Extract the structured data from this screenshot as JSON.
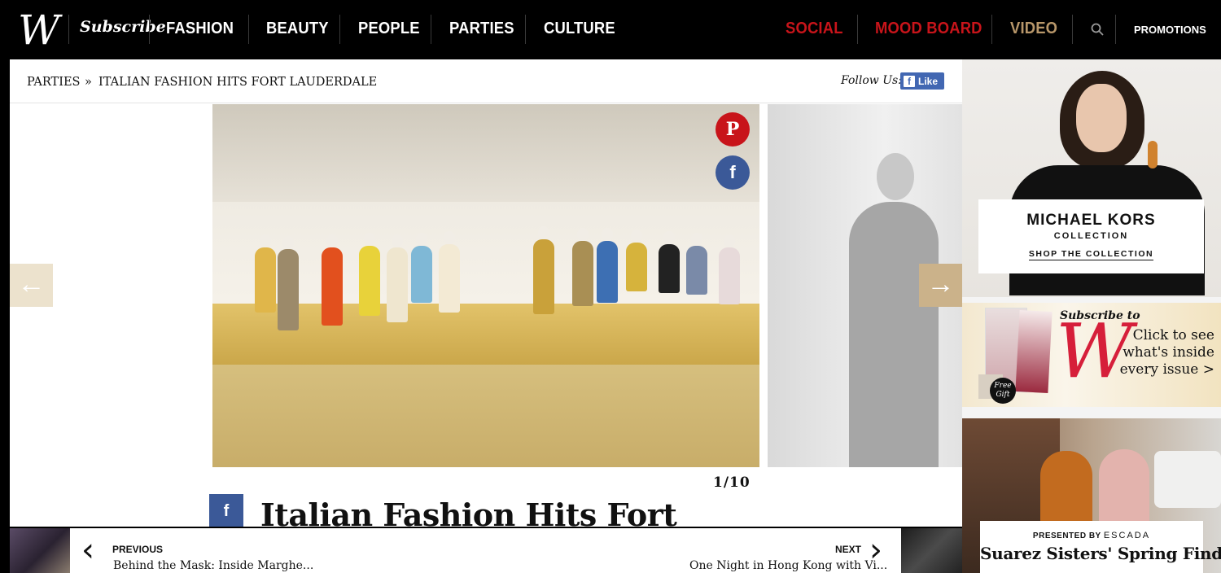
{
  "nav": {
    "logo": "W",
    "subscribe": "Subscribe",
    "items": [
      "FASHION",
      "BEAUTY",
      "PEOPLE",
      "PARTIES",
      "CULTURE"
    ],
    "right_items": [
      "SOCIAL",
      "MOOD BOARD",
      "VIDEO"
    ],
    "promotions": "PROMOTIONS",
    "colors": {
      "social": "#c8141a",
      "mood_board": "#c8141a",
      "video": "#b8976a"
    }
  },
  "breadcrumb": {
    "section": "PARTIES",
    "separator": "»",
    "current": "ITALIAN FASHION HITS FORT LAUDERDALE"
  },
  "follow": {
    "label": "Follow Us:",
    "like": "Like"
  },
  "gallery": {
    "counter": "1/10",
    "headline": "Italian Fashion Hits Fort",
    "share_icons": [
      "pinterest-icon",
      "facebook-icon"
    ]
  },
  "pager": {
    "previous_label": "PREVIOUS",
    "previous_title": "Behind the Mask: Inside Marghe...",
    "next_label": "NEXT",
    "next_title": "One Night in Hong Kong with Vi..."
  },
  "ads": {
    "michael_kors": {
      "title": "MICHAEL KORS",
      "sub": "COLLECTION",
      "cta": "SHOP THE COLLECTION"
    },
    "subscribe": {
      "lead": "Subscribe to",
      "logo": "W",
      "cta": "Click to see what's inside every issue >",
      "gift": "Free Gift"
    },
    "escada": {
      "presented": "PRESENTED BY",
      "brand": "ESCADA",
      "title": "Suarez Sisters' Spring Finds"
    }
  }
}
